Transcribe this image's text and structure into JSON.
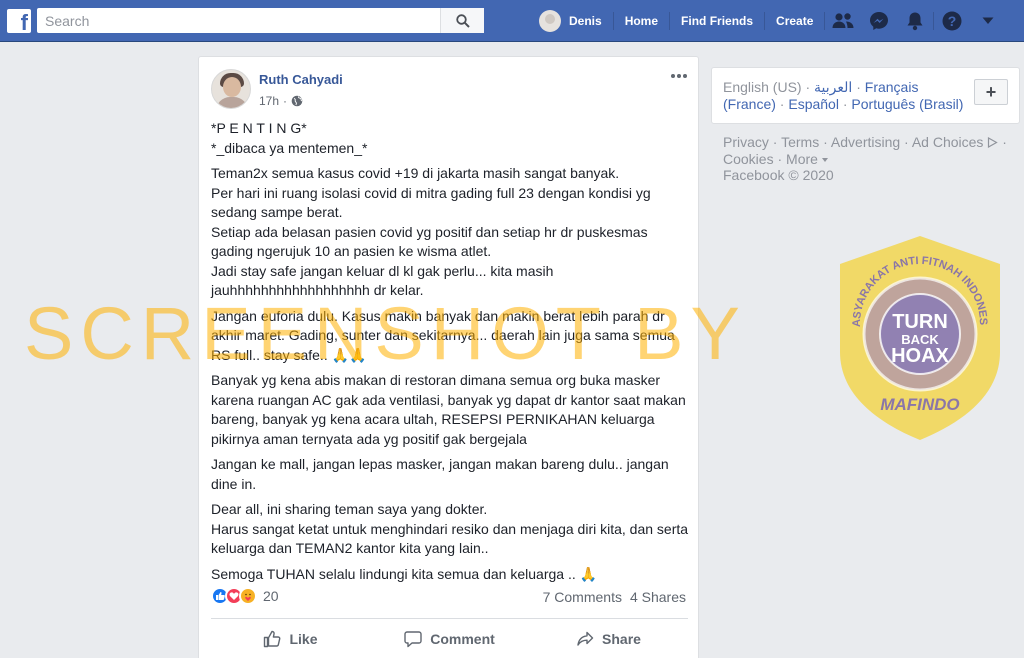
{
  "topbar": {
    "search_placeholder": "Search",
    "user_name": "Denis",
    "home": "Home",
    "find_friends": "Find Friends",
    "create": "Create"
  },
  "post": {
    "author": "Ruth Cahyadi",
    "time": "17h",
    "privacy_icon": "globe-icon",
    "paragraphs": [
      "*P E N T I N G*\n*_dibaca ya mentemen_*",
      "Teman2x semua kasus covid +19 di jakarta masih sangat banyak.\nPer hari ini ruang isolasi covid di mitra gading full 23 dengan kondisi yg sedang sampe berat.\nSetiap ada belasan pasien covid yg positif dan setiap hr dr puskesmas gading ngerujuk 10 an pasien ke wisma atlet.\nJadi stay safe jangan keluar dl kl gak perlu... kita masih jauhhhhhhhhhhhhhhhhhh dr kelar.",
      "Jangan euforia dulu. Kasus makin banyak dan makin berat lebih parah dr akhir maret. Gading, sunter dan sekitarnya... daerah lain juga sama semua RS full.. stay safe.. 🙏🙏",
      "Banyak yg kena abis makan di restoran dimana semua org buka masker karena ruangan AC gak ada ventilasi, banyak yg dapat dr kantor saat makan bareng, banyak yg kena acara ultah, RESEPSI PERNIKAHAN keluarga pikirnya aman ternyata ada yg positif gak bergejala",
      "Jangan ke mall, jangan lepas masker, jangan makan bareng dulu.. jangan dine in.",
      "Dear all, ini sharing teman saya yang dokter.\nHarus sangat ketat untuk menghindari resiko dan menjaga diri kita, dan serta keluarga dan TEMAN2 kantor kita yang lain..",
      "Semoga TUHAN selalu lindungi kita semua dan keluarga .. 🙏"
    ],
    "reaction_count": "20",
    "comments": "7 Comments",
    "shares": "4 Shares",
    "actions": {
      "like": "Like",
      "comment": "Comment",
      "share": "Share"
    }
  },
  "sidebar": {
    "languages": {
      "current": "English (US)",
      "arabic": "العربية",
      "french": "Français (France)",
      "spanish": "Español",
      "portuguese": "Português (Brasil)",
      "add": "+"
    },
    "footer": {
      "privacy": "Privacy",
      "terms": "Terms",
      "advertising": "Advertising",
      "ad_choices": "Ad Choices",
      "cookies": "Cookies",
      "more": "More",
      "copyright": "Facebook © 2020"
    }
  },
  "overlay": {
    "watermark": "SCREENSHOT BY",
    "badge_top": "MASYARAKAT ANTI FITNAH INDONESIA",
    "badge_center_1": "TURN",
    "badge_center_2": "BACK",
    "badge_center_3": "HOAX",
    "badge_bottom": "MAFINDO"
  },
  "colors": {
    "brand": "#4267b2",
    "link": "#385898",
    "watermark": "#ffb000",
    "badge": "#f3d33a",
    "badge_inner": "#8a7fc4"
  }
}
